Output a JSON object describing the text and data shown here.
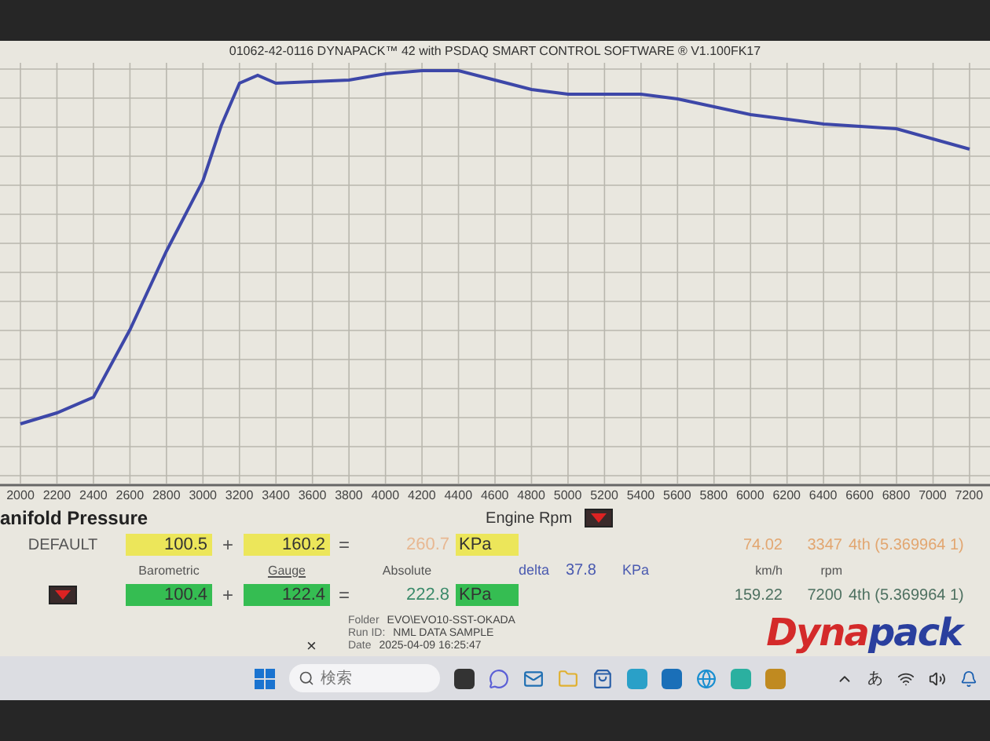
{
  "title": "01062-42-0116 DYNAPACK™ 42 with PSDAQ SMART CONTROL SOFTWARE ® V1.100FK17",
  "chart": {
    "x_ticks": [
      "2000",
      "2200",
      "2400",
      "2600",
      "2800",
      "3000",
      "3200",
      "3400",
      "3600",
      "3800",
      "4000",
      "4200",
      "4400",
      "4600",
      "4800",
      "5000",
      "5200",
      "5400",
      "5600",
      "5800",
      "6000",
      "6200",
      "6400",
      "6600",
      "6800",
      "7000",
      "7200"
    ],
    "x_label": "Engine Rpm"
  },
  "panel": {
    "title": "anifold Pressure",
    "preset": "DEFAULT",
    "rows": [
      {
        "barometric": "100.5",
        "plus": "+",
        "gauge": "160.2",
        "equals": "=",
        "absolute": "260.7",
        "unit": "KPa",
        "color": "#ece65a",
        "speed": "74.02",
        "rpm": "3347",
        "gear": "4th (5.369964 1)"
      },
      {
        "barometric": "100.4",
        "plus": "+",
        "gauge": "122.4",
        "equals": "=",
        "absolute": "222.8",
        "unit": "KPa",
        "color": "#35bd52",
        "speed": "159.22",
        "rpm": "7200",
        "gear": "4th (5.369964 1)"
      }
    ],
    "labels": {
      "barometric": "Barometric",
      "gauge": "Gauge",
      "absolute": "Absolute",
      "delta": "delta",
      "delta_value": "37.8",
      "delta_unit": "KPa",
      "speed_unit": "km/h",
      "rpm_unit": "rpm"
    },
    "folder": {
      "label": "Folder",
      "value": "EVO\\EVO10-SST-OKADA"
    },
    "run_id": {
      "label": "Run ID:",
      "value": "NML DATA SAMPLE"
    },
    "date": {
      "label": "Date",
      "value": "2025-04-09 16:25:47"
    },
    "close": "×",
    "logo": [
      "Dyna",
      "pack"
    ]
  },
  "taskbar": {
    "search_placeholder": "検索",
    "ime": "あ"
  }
}
